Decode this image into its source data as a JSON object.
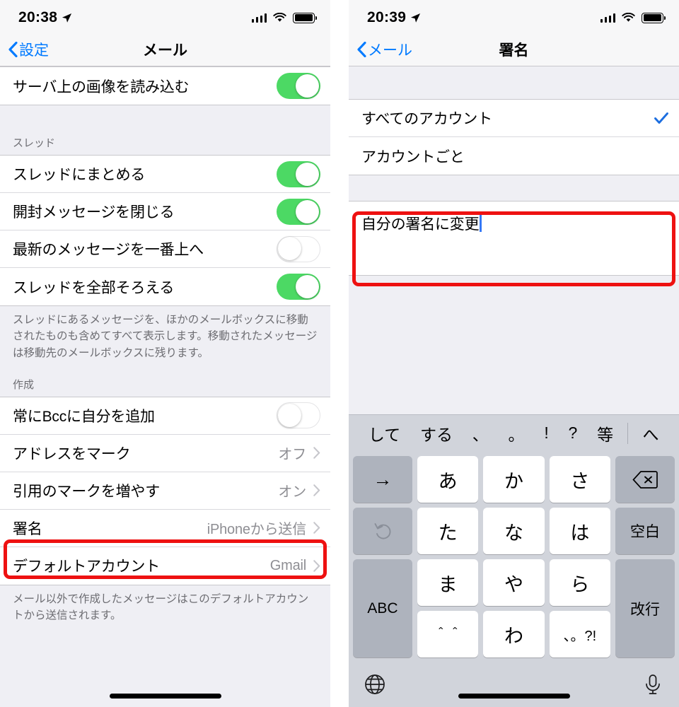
{
  "theme": {
    "accent_blue": "#007aff",
    "toggle_green": "#4cd964",
    "annotation_red": "#ee1111",
    "group_bg": "#efeff4",
    "keyboard_bg": "#d1d4db"
  },
  "left_screen": {
    "status_bar": {
      "time": "20:38",
      "location_icon": "location-arrow-icon",
      "signal_icon": "cellular-signal-icon",
      "wifi_icon": "wifi-icon",
      "battery_icon": "battery-full-icon"
    },
    "nav": {
      "back_label": "設定",
      "title": "メール"
    },
    "groups": [
      {
        "header": "",
        "rows": [
          {
            "label": "サーバ上の画像を読み込む",
            "type": "toggle",
            "state": "on"
          }
        ]
      },
      {
        "header": "スレッド",
        "rows": [
          {
            "label": "スレッドにまとめる",
            "type": "toggle",
            "state": "on"
          },
          {
            "label": "開封メッセージを閉じる",
            "type": "toggle",
            "state": "on"
          },
          {
            "label": "最新のメッセージを一番上へ",
            "type": "toggle",
            "state": "off"
          },
          {
            "label": "スレッドを全部そろえる",
            "type": "toggle",
            "state": "on"
          }
        ],
        "footnote": "スレッドにあるメッセージを、ほかのメールボックスに移動されたものも含めてすべて表示します。移動されたメッセージは移動先のメールボックスに残ります。"
      },
      {
        "header": "作成",
        "rows": [
          {
            "label": "常にBccに自分を追加",
            "type": "toggle",
            "state": "off"
          },
          {
            "label": "アドレスをマーク",
            "type": "disclosure",
            "value": "オフ"
          },
          {
            "label": "引用のマークを増やす",
            "type": "disclosure",
            "value": "オン"
          },
          {
            "label": "署名",
            "type": "disclosure",
            "value": "iPhoneから送信",
            "highlighted": true
          },
          {
            "label": "デフォルトアカウント",
            "type": "disclosure",
            "value": "Gmail"
          }
        ],
        "footnote": "メール以外で作成したメッセージはこのデフォルトアカウントから送信されます。"
      }
    ]
  },
  "right_screen": {
    "status_bar": {
      "time": "20:39",
      "location_icon": "location-arrow-icon",
      "signal_icon": "cellular-signal-icon",
      "wifi_icon": "wifi-icon",
      "battery_icon": "battery-full-icon"
    },
    "nav": {
      "back_label": "メール",
      "title": "署名"
    },
    "account_options": [
      {
        "label": "すべてのアカウント",
        "selected": true
      },
      {
        "label": "アカウントごと",
        "selected": false
      }
    ],
    "signature_field": {
      "value": "自分の署名に変更",
      "caret_visible": true,
      "highlighted": true
    },
    "keyboard": {
      "predictive": [
        "して",
        "する",
        "、",
        "。",
        "!",
        "?",
        "等"
      ],
      "predictive_last": "へ",
      "keys": [
        {
          "label": "→",
          "kind": "fn"
        },
        {
          "label": "あ",
          "kind": "char"
        },
        {
          "label": "か",
          "kind": "char"
        },
        {
          "label": "さ",
          "kind": "char"
        },
        {
          "label": "⌫",
          "kind": "fn",
          "name": "delete-key"
        },
        {
          "label": "↺",
          "kind": "fn dim",
          "name": "undo-key"
        },
        {
          "label": "た",
          "kind": "char"
        },
        {
          "label": "な",
          "kind": "char"
        },
        {
          "label": "は",
          "kind": "char"
        },
        {
          "label": "空白",
          "kind": "fn sm",
          "name": "space-key"
        },
        {
          "label": "ABC",
          "kind": "fn sm span2",
          "name": "abc-key"
        },
        {
          "label": "ま",
          "kind": "char"
        },
        {
          "label": "や",
          "kind": "char"
        },
        {
          "label": "ら",
          "kind": "char"
        },
        {
          "label": "改行",
          "kind": "fn sm span2",
          "name": "return-key"
        },
        {
          "label": "＾＾",
          "kind": "char small",
          "name": "emoticon-key"
        },
        {
          "label": "わ",
          "kind": "char",
          "name": "wa-key"
        },
        {
          "label": "、。?!",
          "kind": "char small",
          "name": "punctuation-key"
        }
      ],
      "globe_icon": "globe-icon",
      "mic_icon": "microphone-icon"
    }
  }
}
